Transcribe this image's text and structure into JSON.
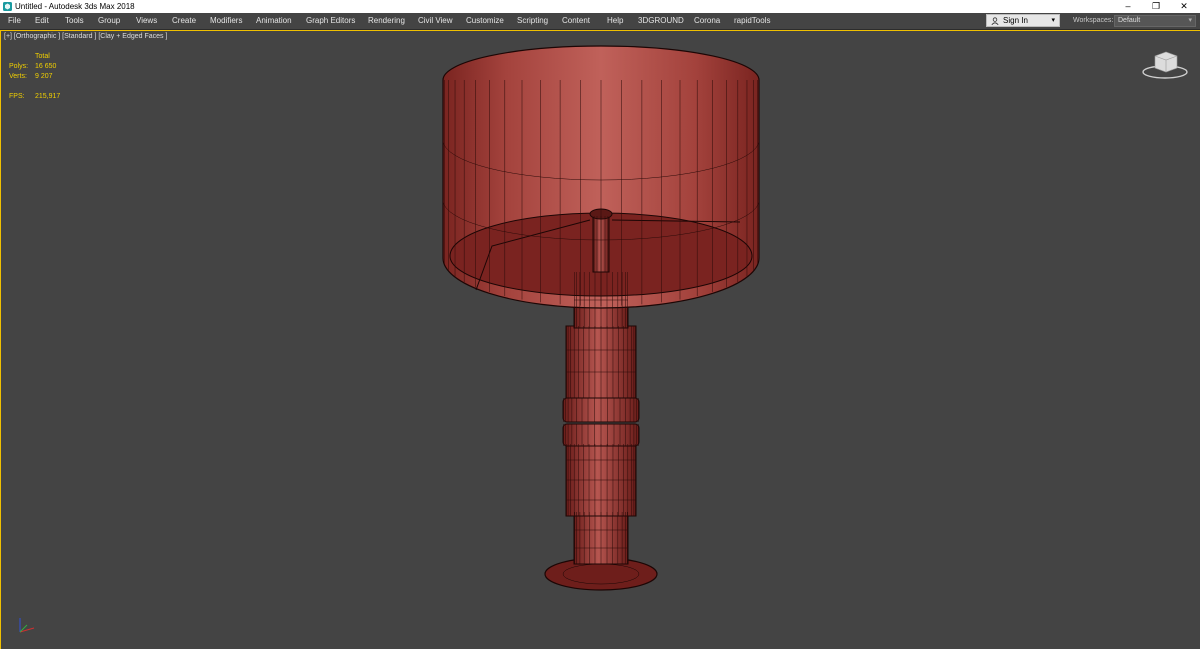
{
  "window": {
    "title": "Untitled - Autodesk 3ds Max 2018"
  },
  "window_controls": {
    "minimize": "–",
    "maximize": "❐",
    "close": "✕"
  },
  "menu": [
    "File",
    "Edit",
    "Tools",
    "Group",
    "Views",
    "Create",
    "Modifiers",
    "Animation",
    "Graph Editors",
    "Rendering",
    "Civil View",
    "Customize",
    "Scripting",
    "Content",
    "Help",
    "3DGROUND",
    "Corona",
    "rapidTools"
  ],
  "account": {
    "signin_label": "Sign In",
    "dropdown_glyph": "▾"
  },
  "workspaces": {
    "label": "Workspaces:",
    "value": "Default",
    "dropdown_glyph": "▾"
  },
  "viewport": {
    "label": "[+] [Orthographic ] [Standard ] [Clay + Edged Faces ]",
    "stats": {
      "header": "Total",
      "polys_label": "Polys:",
      "polys_value": "16 650",
      "verts_label": "Verts:",
      "verts_value": "9 207",
      "fps_label": "FPS:",
      "fps_value": "215,917"
    }
  },
  "colors": {
    "viewport_bg": "#444444",
    "active_border": "#f0c000",
    "stats_text": "#f2d000",
    "mesh_fill": "#a84a44",
    "mesh_wire": "#2a0a08"
  }
}
